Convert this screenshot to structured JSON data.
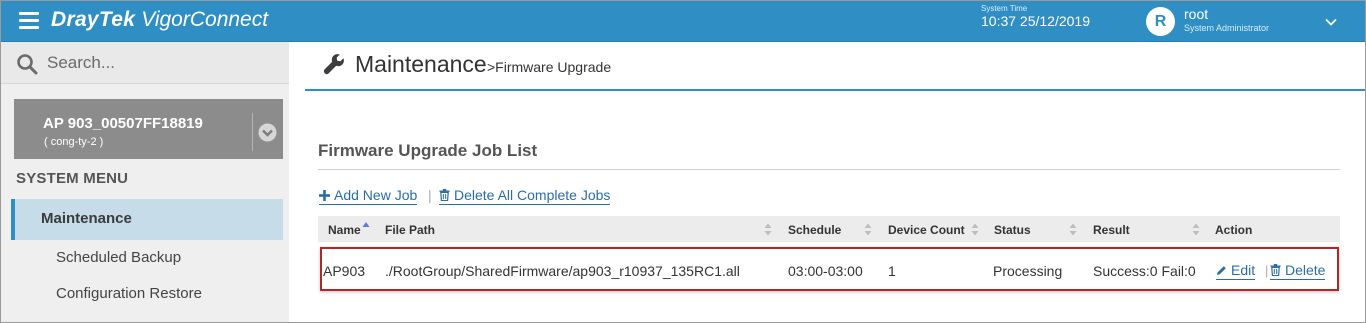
{
  "header": {
    "brand_primary": "DrayTek",
    "brand_secondary": "VigorConnect",
    "system_time_label": "System Time",
    "system_time": "10:37 25/12/2019",
    "avatar_letter": "R",
    "user_name": "root",
    "user_role": "System Administrator",
    "accent_color": "#2f8fc5"
  },
  "sidebar": {
    "search_placeholder": "Search...",
    "device_name": "AP 903_00507FF18819",
    "device_group": "( cong-ty-2 )",
    "menu_title": "SYSTEM MENU",
    "active_item": "Maintenance",
    "sub_items": [
      "Scheduled Backup",
      "Configuration Restore"
    ]
  },
  "page": {
    "title": "Maintenance",
    "breadcrumb": ">Firmware Upgrade",
    "section_title": "Firmware Upgrade Job List",
    "add_job_label": "Add New Job",
    "delete_all_label": "Delete All Complete Jobs",
    "action_separator": "|"
  },
  "table": {
    "columns": [
      "Name",
      "File Path",
      "Schedule",
      "Device Count",
      "Status",
      "Result",
      "Action"
    ],
    "rows": [
      {
        "name": "AP903",
        "file_path": "./RootGroup/SharedFirmware/ap903_r10937_135RC1.all",
        "schedule": "03:00-03:00",
        "device_count": "1",
        "status": "Processing",
        "result": "Success:0 Fail:0",
        "edit_label": "Edit",
        "delete_label": "Delete"
      }
    ],
    "highlight_color": "#b3262a"
  }
}
